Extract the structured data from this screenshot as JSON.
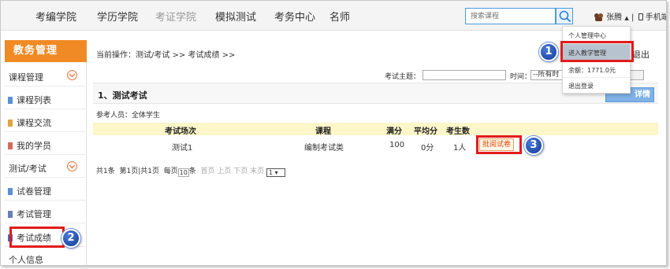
{
  "topnav": {
    "items": [
      {
        "label": "考编学院",
        "disabled": false
      },
      {
        "label": "学历学院",
        "disabled": false
      },
      {
        "label": "考证学院",
        "disabled": true
      },
      {
        "label": "模拟测试",
        "disabled": false
      },
      {
        "label": "考务中心",
        "disabled": false
      },
      {
        "label": "名师",
        "disabled": false
      }
    ],
    "search_placeholder": "搜索课程",
    "user_name": "张腾",
    "user_caret": "▲",
    "separator": "|",
    "mobile_label": "手机端"
  },
  "user_menu": {
    "items": [
      {
        "label": "个人管理中心"
      },
      {
        "label": "进入教学管理"
      },
      {
        "label": "余额：1771.0元"
      },
      {
        "label": "退出登录"
      }
    ]
  },
  "sidebar": {
    "title": "教务管理",
    "groups": [
      {
        "label": "课程管理",
        "items": [
          "课程列表",
          "课程交流",
          "我的学员"
        ]
      },
      {
        "label": "测试/考试",
        "items": [
          "试卷管理",
          "考试管理",
          "考试成绩"
        ]
      }
    ],
    "footer_label": "个人信息"
  },
  "main": {
    "breadcrumb": "当前操作：测试/考试 >> 考试成绩 >>",
    "exit_label": "退出",
    "filter": {
      "subject_label": "考试主题：",
      "time_label": "时间：",
      "time_value": "--所有时"
    },
    "section_title": "1、测试考试",
    "detail_button": "详情",
    "participants": "参考人员：全体学生",
    "table": {
      "headers": [
        "考试场次",
        "课程",
        "满分",
        "平均分",
        "考生数"
      ],
      "rows": [
        {
          "session": "测试1",
          "course": "编制考试类",
          "full_score": "100",
          "average": "0分",
          "examinees": "1人",
          "action": "批阅试卷"
        }
      ]
    },
    "pager": {
      "total": "共1条",
      "page_info": "第1页|共1页",
      "per_page_prefix": "每页",
      "per_page_value": "10",
      "per_page_suffix": "条",
      "first": "首页",
      "prev": "上页",
      "next": "下页",
      "last": "末页",
      "goto_value": "1"
    }
  },
  "badges": [
    "1",
    "2",
    "3"
  ],
  "colors": {
    "accent_orange": "#f08a24",
    "highlight_red": "#e21b1b",
    "badge_blue": "#1a4aa8",
    "table_header_bg": "#fcf6c9"
  }
}
